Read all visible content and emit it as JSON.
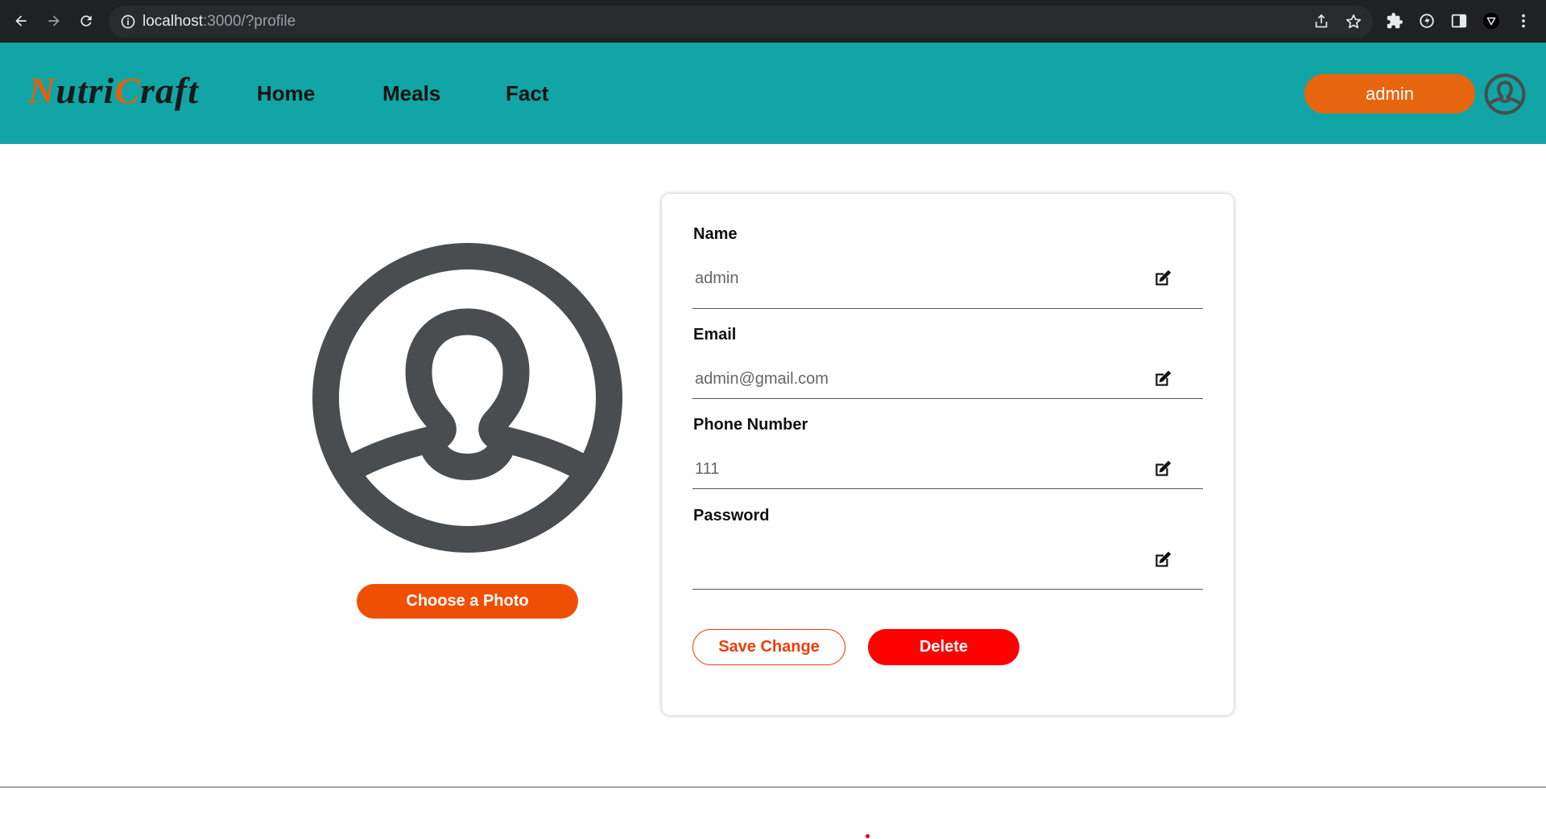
{
  "browser": {
    "url_host": "localhost",
    "url_rest": ":3000/?profile"
  },
  "header": {
    "logo_part1": "N",
    "logo_part2": "utri",
    "logo_part3": "C",
    "logo_part4": "raft",
    "nav": [
      {
        "label": "Home"
      },
      {
        "label": "Meals"
      },
      {
        "label": "Fact"
      }
    ],
    "user_label": "admin"
  },
  "profile": {
    "choose_photo_label": "Choose a Photo",
    "fields": [
      {
        "label": "Name",
        "value": "admin"
      },
      {
        "label": "Email",
        "value": "admin@gmail.com"
      },
      {
        "label": "Phone Number",
        "value": "111"
      },
      {
        "label": "Password",
        "value": ""
      }
    ],
    "save_label": "Save Change",
    "delete_label": "Delete"
  },
  "colors": {
    "header_bg": "#12a5a5",
    "accent_orange": "#e8650f",
    "delete_red": "#ff0000",
    "avatar_gray": "#4a4d50"
  },
  "icons": [
    "back-arrow-icon",
    "forward-arrow-icon",
    "reload-icon",
    "info-icon",
    "share-icon",
    "star-icon",
    "puzzle-icon",
    "sync-icon",
    "sidebar-icon",
    "profile-extension-icon",
    "kebab-menu-icon",
    "user-circle-icon",
    "edit-icon"
  ]
}
